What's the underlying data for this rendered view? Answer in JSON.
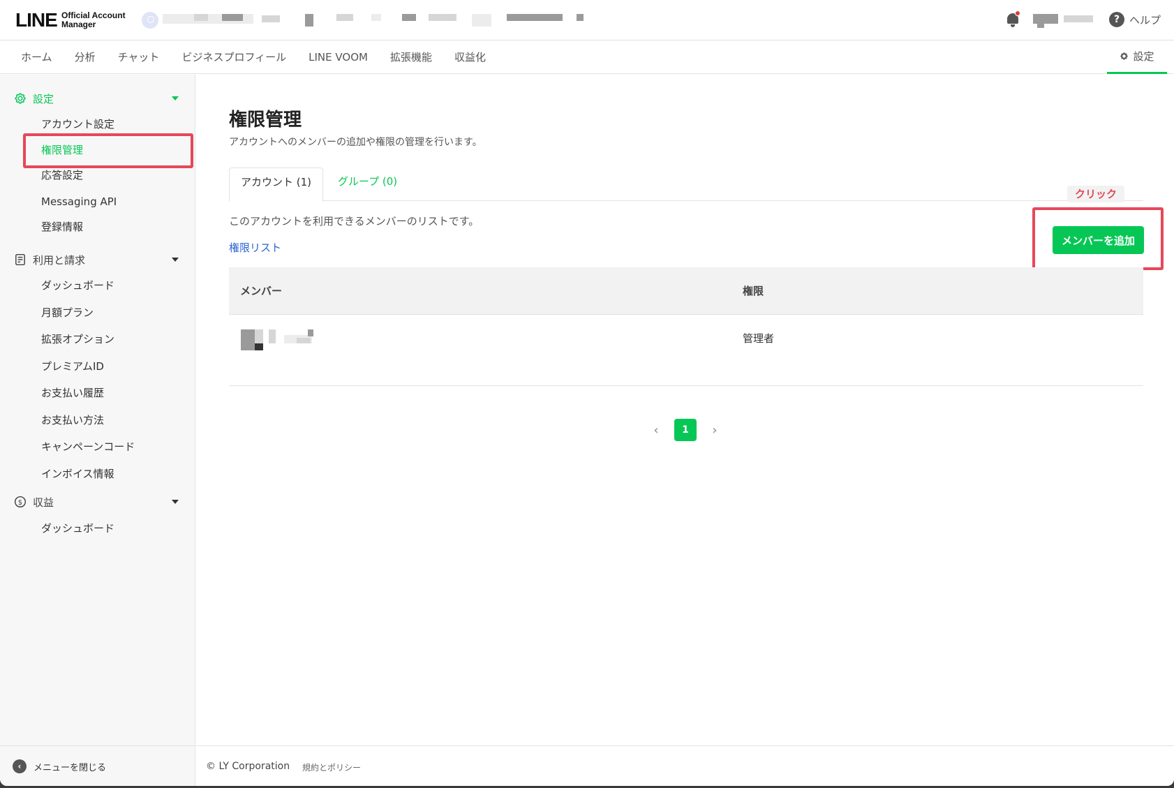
{
  "header": {
    "logo_main": "LINE",
    "logo_sub_line1": "Official Account",
    "logo_sub_line2": "Manager",
    "help_label": "ヘルプ"
  },
  "nav": {
    "items": [
      "ホーム",
      "分析",
      "チャット",
      "ビジネスプロフィール",
      "LINE VOOM",
      "拡張機能",
      "収益化"
    ],
    "settings_label": "設定"
  },
  "sidebar": {
    "groups": [
      {
        "label": "設定",
        "items": [
          "アカウント設定",
          "権限管理",
          "応答設定",
          "Messaging API",
          "登録情報"
        ]
      },
      {
        "label": "利用と請求",
        "items": [
          "ダッシュボード",
          "月額プラン",
          "拡張オプション",
          "プレミアムID",
          "お支払い履歴",
          "お支払い方法",
          "キャンペーンコード",
          "インボイス情報"
        ]
      },
      {
        "label": "収益",
        "items": [
          "ダッシュボード"
        ]
      }
    ],
    "active_item": "権限管理",
    "close_menu_label": "メニューを閉じる"
  },
  "main": {
    "title": "権限管理",
    "description": "アカウントへのメンバーの追加や権限の管理を行います。",
    "tabs": [
      "アカウント (1)",
      "グループ (0)"
    ],
    "list_description": "このアカウントを利用できるメンバーのリストです。",
    "permission_list_link": "権限リスト",
    "annotation_label": "クリック",
    "add_member_button": "メンバーを追加",
    "table": {
      "columns": [
        "メンバー",
        "権限"
      ],
      "rows": [
        {
          "member": "",
          "role": "管理者"
        }
      ]
    },
    "pagination": {
      "current_page": "1",
      "prev_symbol": "‹",
      "next_symbol": "›"
    }
  },
  "footer": {
    "copyright": "© LY Corporation",
    "policy_link": "規約とポリシー"
  },
  "colors": {
    "accent": "#06c755",
    "annotation": "#e54859",
    "link": "#2a62d6"
  }
}
